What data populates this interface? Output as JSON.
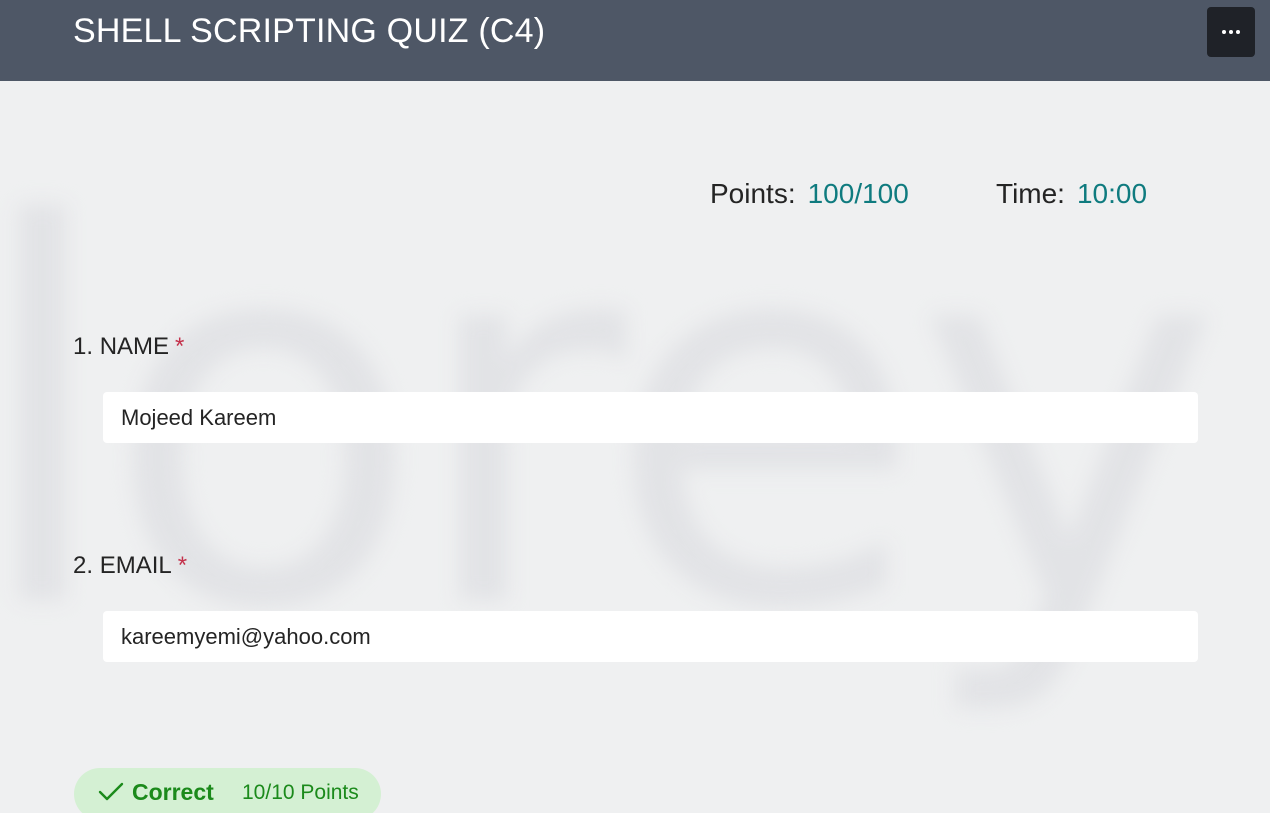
{
  "header": {
    "title": "SHELL SCRIPTING QUIZ (C4)",
    "more_label": "More options"
  },
  "stats": {
    "points_label": "Points:",
    "points_value": "100/100",
    "time_label": "Time:",
    "time_value": "10:00"
  },
  "questions": [
    {
      "number": "1.",
      "label": "NAME",
      "required_mark": "*",
      "value": "Mojeed Kareem"
    },
    {
      "number": "2.",
      "label": "EMAIL",
      "required_mark": "*",
      "value": "kareemyemi@yahoo.com"
    }
  ],
  "result": {
    "status": "Correct",
    "points": "10/10 Points",
    "icon": "checkmark-icon"
  },
  "colors": {
    "header_bg": "#4e5766",
    "accent_teal": "#0f7b7f",
    "required_red": "#c4314b",
    "correct_green": "#1b8a1b",
    "correct_bg": "#d4f0d3",
    "page_bg": "#eff0f1"
  }
}
